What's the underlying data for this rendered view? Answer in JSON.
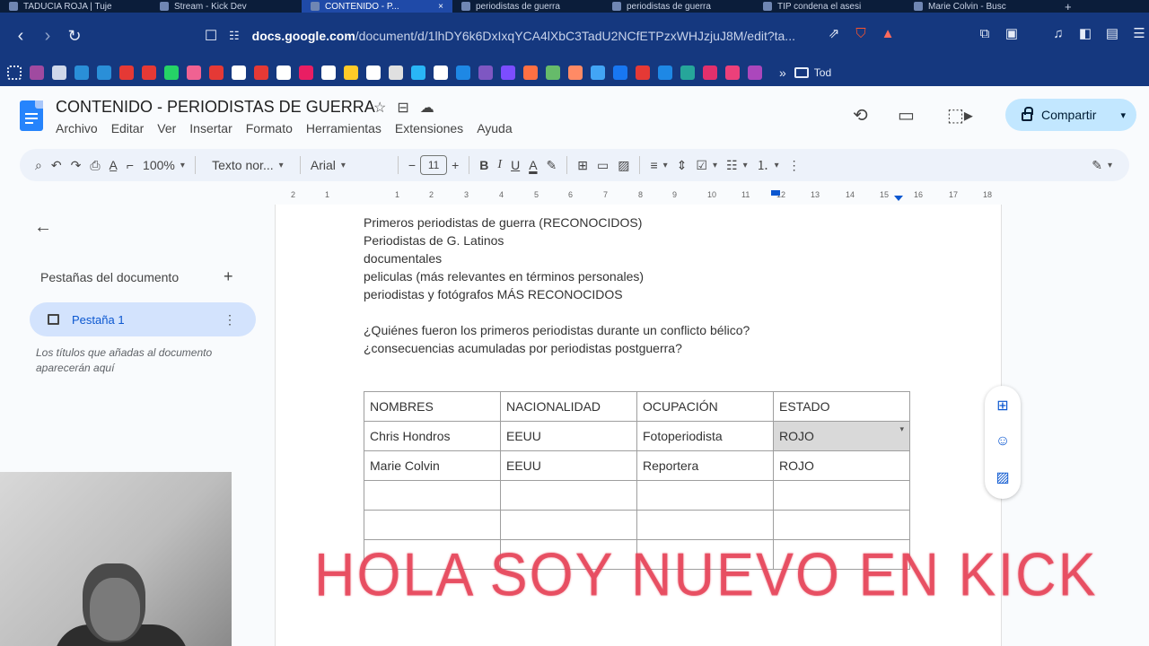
{
  "browser": {
    "tabs": [
      {
        "label": "TADUCIA ROJA | Tuje",
        "active": false
      },
      {
        "label": "Stream - Kick Dev",
        "active": false
      },
      {
        "label": "CONTENIDO - P...",
        "active": true
      },
      {
        "label": "periodistas de guerra",
        "active": false
      },
      {
        "label": "periodistas de guerra",
        "active": false
      },
      {
        "label": "TIP condena el asesi",
        "active": false
      },
      {
        "label": "Marie Colvin - Busc",
        "active": false
      }
    ],
    "url_domain": "docs.google.com",
    "url_path": "/document/d/1lhDY6k6DxIxqYCA4lXbC3TadU2NCfETPzxWHJzjuJ8M/edit?ta...",
    "bookmarks_todos": "Tod"
  },
  "doc": {
    "title": "CONTENIDO - PERIODISTAS DE GUERRA",
    "menu": [
      "Archivo",
      "Editar",
      "Ver",
      "Insertar",
      "Formato",
      "Herramientas",
      "Extensiones",
      "Ayuda"
    ],
    "share_label": "Compartir"
  },
  "toolbar": {
    "zoom": "100%",
    "style": "Texto nor...",
    "font": "Arial",
    "font_size": "11"
  },
  "ruler_ticks": [
    "2",
    "1",
    "1",
    "2",
    "3",
    "4",
    "5",
    "6",
    "7",
    "8",
    "9",
    "10",
    "11",
    "12",
    "13",
    "14",
    "15",
    "16",
    "17",
    "18"
  ],
  "sidebar": {
    "title": "Pestañas del documento",
    "tab_label": "Pestaña 1",
    "hint": "Los títulos que añadas al documento aparecerán aquí"
  },
  "body": {
    "lines": [
      "Primeros periodistas de guerra (RECONOCIDOS)",
      "Periodistas de G. Latinos",
      "documentales",
      "peliculas (más relevantes en términos personales)",
      "periodistas y fotógrafos MÁS RECONOCIDOS",
      "¿Quiénes fueron los primeros periodistas durante un conflicto bélico?",
      "¿consecuencias acumuladas por periodistas postguerra?"
    ],
    "table": {
      "header": [
        "NOMBRES",
        "NACIONALIDAD",
        "OCUPACIÓN",
        "ESTADO"
      ],
      "rows": [
        [
          "Chris Hondros",
          "EEUU",
          "Fotoperiodista",
          "ROJO"
        ],
        [
          "Marie Colvin",
          "EEUU",
          "Reportera",
          "ROJO"
        ],
        [
          "",
          "",
          "",
          ""
        ],
        [
          "",
          "",
          "",
          ""
        ],
        [
          "",
          "",
          "",
          ""
        ]
      ]
    }
  },
  "overlay": {
    "text": "HOLA SOY NUEVO EN KICK"
  }
}
